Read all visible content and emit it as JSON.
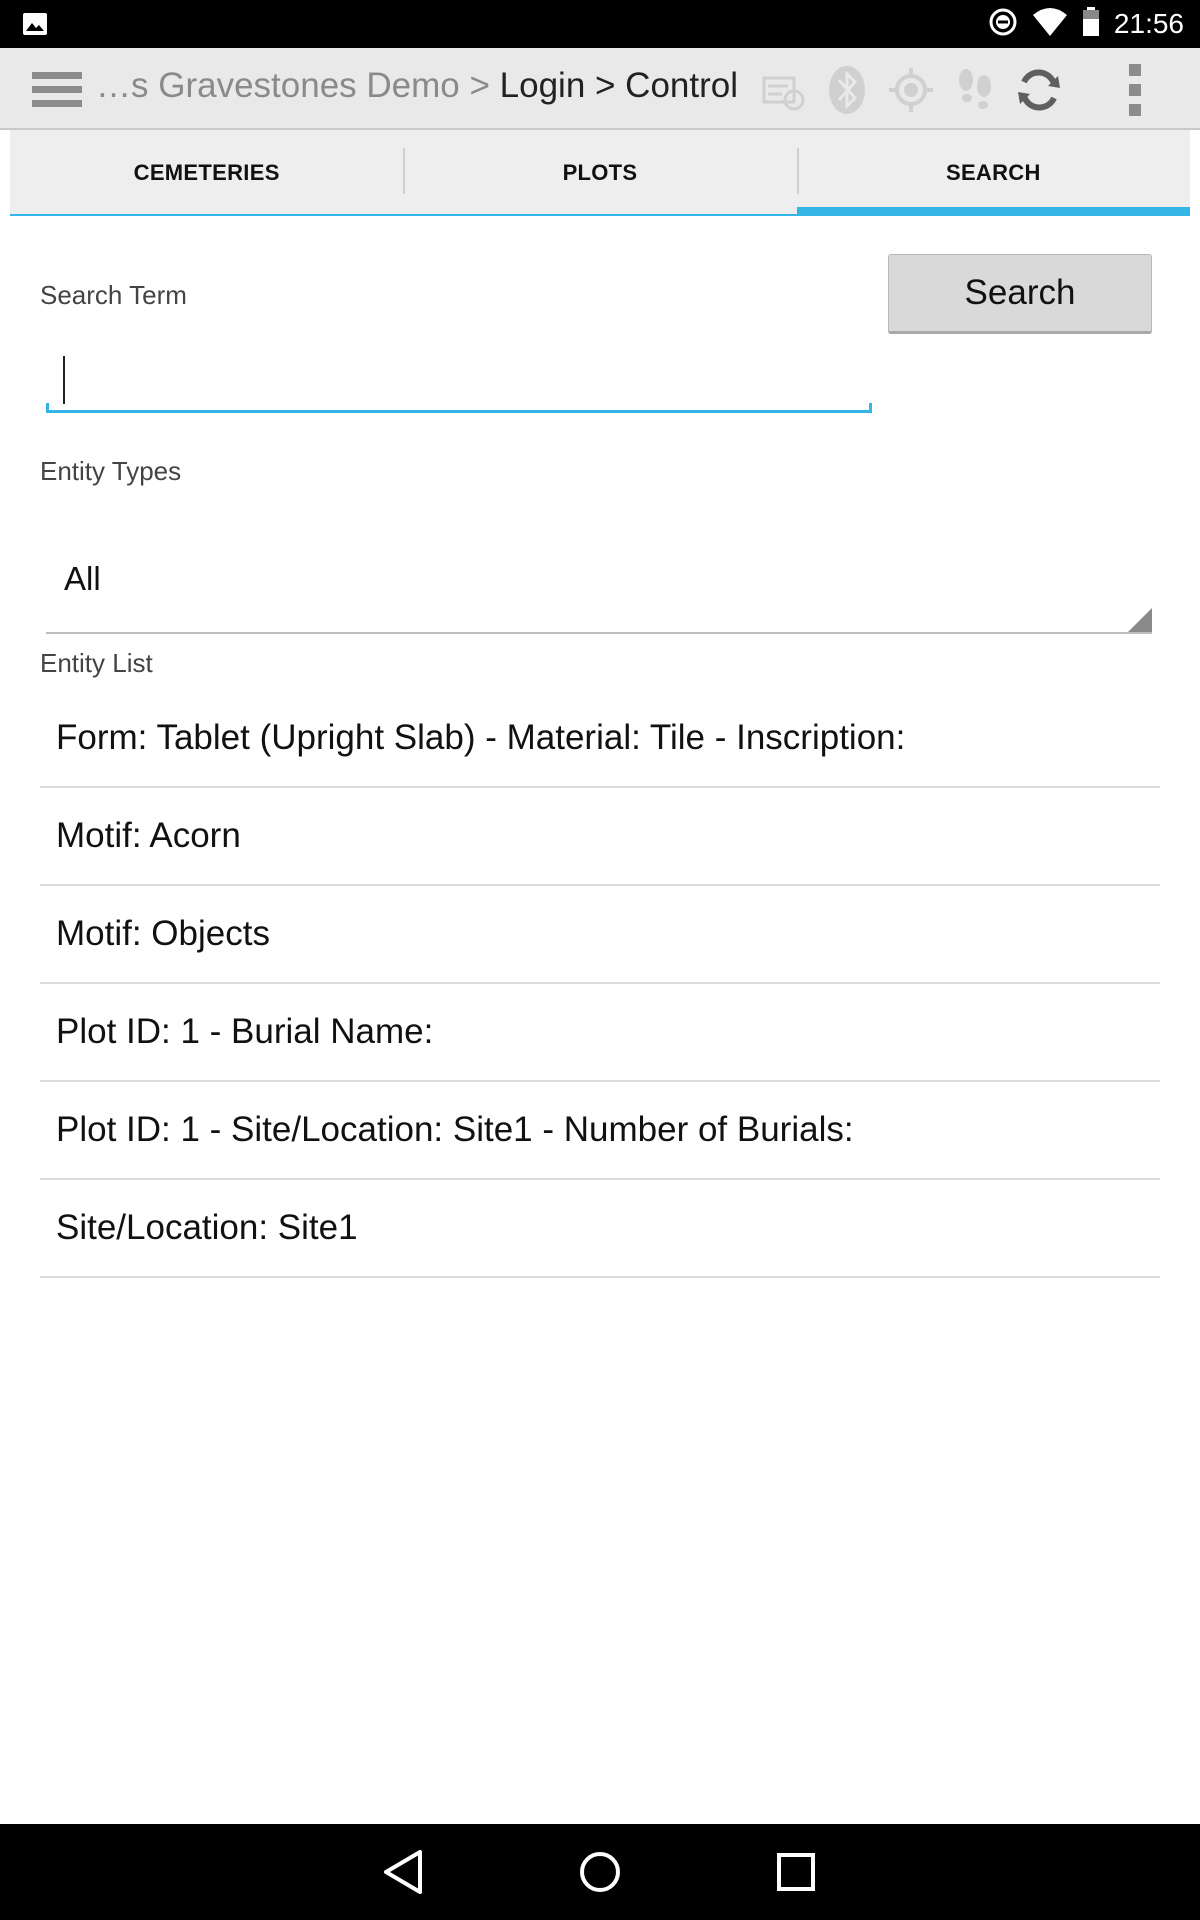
{
  "status_bar": {
    "time": "21:56",
    "icons": [
      "gallery-notification-icon",
      "do-not-disturb-icon",
      "wifi-icon",
      "battery-icon"
    ]
  },
  "action_bar": {
    "breadcrumb_dim": "…s Gravestones Demo > ",
    "breadcrumb_dark": "Login > Control",
    "icons": [
      "menu-icon",
      "sync-status-icon",
      "bluetooth-icon",
      "gps-icon",
      "tracking-icon",
      "sync-icon",
      "overflow-menu-icon"
    ]
  },
  "tabs": [
    {
      "label": "CEMETERIES",
      "active": false
    },
    {
      "label": "PLOTS",
      "active": false
    },
    {
      "label": "SEARCH",
      "active": true
    }
  ],
  "search": {
    "term_label": "Search Term",
    "button_label": "Search",
    "input_value": ""
  },
  "entity_types": {
    "label": "Entity Types",
    "selected": "All"
  },
  "entity_list": {
    "label": "Entity List",
    "items": [
      "Form: Tablet (Upright Slab) - Material: Tile - Inscription:",
      "Motif: Acorn",
      "Motif: Objects",
      "Plot ID: 1 - Burial Name:",
      "Plot ID: 1 - Site/Location: Site1 - Number of Burials:",
      "Site/Location: Site1"
    ]
  },
  "colors": {
    "accent": "#33b5e5",
    "action_bar": "#e9e9e9",
    "tab_bg": "#eeeeee"
  }
}
